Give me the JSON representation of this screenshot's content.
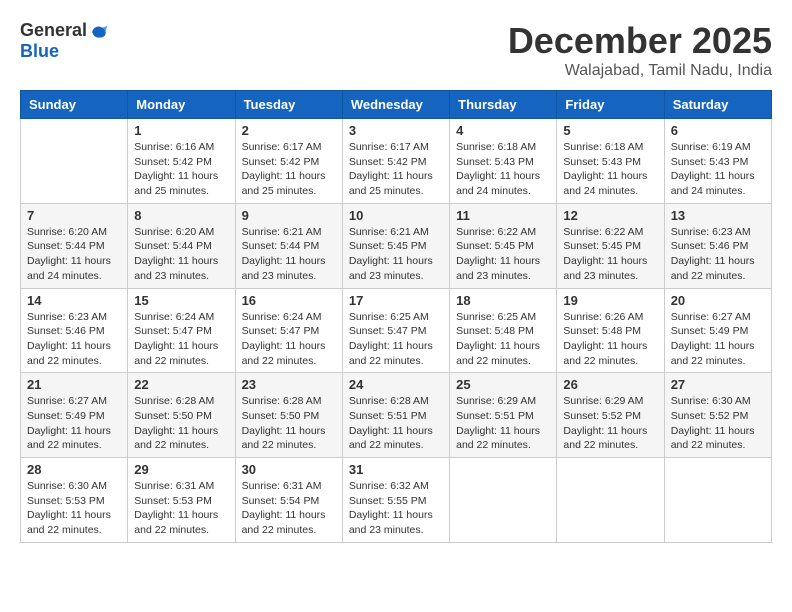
{
  "logo": {
    "general": "General",
    "blue": "Blue"
  },
  "title": "December 2025",
  "location": "Walajabad, Tamil Nadu, India",
  "weekdays": [
    "Sunday",
    "Monday",
    "Tuesday",
    "Wednesday",
    "Thursday",
    "Friday",
    "Saturday"
  ],
  "weeks": [
    [
      {
        "day": "",
        "info": ""
      },
      {
        "day": "1",
        "info": "Sunrise: 6:16 AM\nSunset: 5:42 PM\nDaylight: 11 hours\nand 25 minutes."
      },
      {
        "day": "2",
        "info": "Sunrise: 6:17 AM\nSunset: 5:42 PM\nDaylight: 11 hours\nand 25 minutes."
      },
      {
        "day": "3",
        "info": "Sunrise: 6:17 AM\nSunset: 5:42 PM\nDaylight: 11 hours\nand 25 minutes."
      },
      {
        "day": "4",
        "info": "Sunrise: 6:18 AM\nSunset: 5:43 PM\nDaylight: 11 hours\nand 24 minutes."
      },
      {
        "day": "5",
        "info": "Sunrise: 6:18 AM\nSunset: 5:43 PM\nDaylight: 11 hours\nand 24 minutes."
      },
      {
        "day": "6",
        "info": "Sunrise: 6:19 AM\nSunset: 5:43 PM\nDaylight: 11 hours\nand 24 minutes."
      }
    ],
    [
      {
        "day": "7",
        "info": "Sunrise: 6:20 AM\nSunset: 5:44 PM\nDaylight: 11 hours\nand 24 minutes."
      },
      {
        "day": "8",
        "info": "Sunrise: 6:20 AM\nSunset: 5:44 PM\nDaylight: 11 hours\nand 23 minutes."
      },
      {
        "day": "9",
        "info": "Sunrise: 6:21 AM\nSunset: 5:44 PM\nDaylight: 11 hours\nand 23 minutes."
      },
      {
        "day": "10",
        "info": "Sunrise: 6:21 AM\nSunset: 5:45 PM\nDaylight: 11 hours\nand 23 minutes."
      },
      {
        "day": "11",
        "info": "Sunrise: 6:22 AM\nSunset: 5:45 PM\nDaylight: 11 hours\nand 23 minutes."
      },
      {
        "day": "12",
        "info": "Sunrise: 6:22 AM\nSunset: 5:45 PM\nDaylight: 11 hours\nand 23 minutes."
      },
      {
        "day": "13",
        "info": "Sunrise: 6:23 AM\nSunset: 5:46 PM\nDaylight: 11 hours\nand 22 minutes."
      }
    ],
    [
      {
        "day": "14",
        "info": "Sunrise: 6:23 AM\nSunset: 5:46 PM\nDaylight: 11 hours\nand 22 minutes."
      },
      {
        "day": "15",
        "info": "Sunrise: 6:24 AM\nSunset: 5:47 PM\nDaylight: 11 hours\nand 22 minutes."
      },
      {
        "day": "16",
        "info": "Sunrise: 6:24 AM\nSunset: 5:47 PM\nDaylight: 11 hours\nand 22 minutes."
      },
      {
        "day": "17",
        "info": "Sunrise: 6:25 AM\nSunset: 5:47 PM\nDaylight: 11 hours\nand 22 minutes."
      },
      {
        "day": "18",
        "info": "Sunrise: 6:25 AM\nSunset: 5:48 PM\nDaylight: 11 hours\nand 22 minutes."
      },
      {
        "day": "19",
        "info": "Sunrise: 6:26 AM\nSunset: 5:48 PM\nDaylight: 11 hours\nand 22 minutes."
      },
      {
        "day": "20",
        "info": "Sunrise: 6:27 AM\nSunset: 5:49 PM\nDaylight: 11 hours\nand 22 minutes."
      }
    ],
    [
      {
        "day": "21",
        "info": "Sunrise: 6:27 AM\nSunset: 5:49 PM\nDaylight: 11 hours\nand 22 minutes."
      },
      {
        "day": "22",
        "info": "Sunrise: 6:28 AM\nSunset: 5:50 PM\nDaylight: 11 hours\nand 22 minutes."
      },
      {
        "day": "23",
        "info": "Sunrise: 6:28 AM\nSunset: 5:50 PM\nDaylight: 11 hours\nand 22 minutes."
      },
      {
        "day": "24",
        "info": "Sunrise: 6:28 AM\nSunset: 5:51 PM\nDaylight: 11 hours\nand 22 minutes."
      },
      {
        "day": "25",
        "info": "Sunrise: 6:29 AM\nSunset: 5:51 PM\nDaylight: 11 hours\nand 22 minutes."
      },
      {
        "day": "26",
        "info": "Sunrise: 6:29 AM\nSunset: 5:52 PM\nDaylight: 11 hours\nand 22 minutes."
      },
      {
        "day": "27",
        "info": "Sunrise: 6:30 AM\nSunset: 5:52 PM\nDaylight: 11 hours\nand 22 minutes."
      }
    ],
    [
      {
        "day": "28",
        "info": "Sunrise: 6:30 AM\nSunset: 5:53 PM\nDaylight: 11 hours\nand 22 minutes."
      },
      {
        "day": "29",
        "info": "Sunrise: 6:31 AM\nSunset: 5:53 PM\nDaylight: 11 hours\nand 22 minutes."
      },
      {
        "day": "30",
        "info": "Sunrise: 6:31 AM\nSunset: 5:54 PM\nDaylight: 11 hours\nand 22 minutes."
      },
      {
        "day": "31",
        "info": "Sunrise: 6:32 AM\nSunset: 5:55 PM\nDaylight: 11 hours\nand 23 minutes."
      },
      {
        "day": "",
        "info": ""
      },
      {
        "day": "",
        "info": ""
      },
      {
        "day": "",
        "info": ""
      }
    ]
  ]
}
